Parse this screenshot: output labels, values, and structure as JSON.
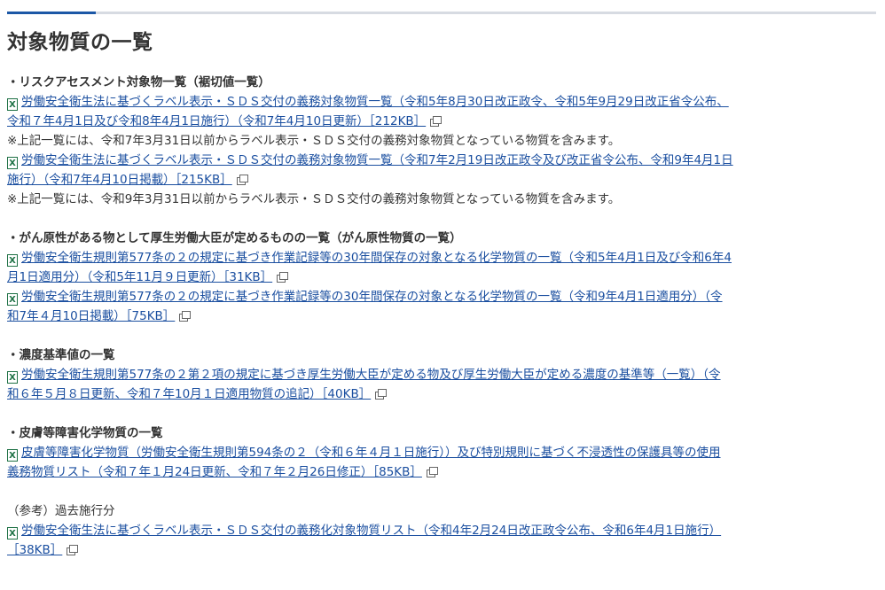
{
  "page_title": "対象物質の一覧",
  "colors": {
    "accent": "#1b57a6",
    "link": "#1b4fa0",
    "excel_icon": "#1e7145"
  },
  "sections": [
    {
      "heading": "・リスクアセスメント対象物一覧（裾切値一覧）",
      "items": [
        {
          "type": "link",
          "icon": "excel-icon",
          "line1": "労働安全衛生法に基づくラベル表示・ＳＤＳ交付の義務対象物質一覧（令和5年8月30日改正政令、令和5年9月29日改正省令公布、",
          "line2": "令和７年4月1日及び令和8年4月1日施行）（令和7年4月10日更新）［212KB］"
        },
        {
          "type": "note",
          "text": "※上記一覧には、令和7年3月31日以前からラベル表示・ＳＤＳ交付の義務対象物質となっている物質を含みます。"
        },
        {
          "type": "link",
          "icon": "excel-icon",
          "line1": "労働安全衛生法に基づくラベル表示・ＳＤＳ交付の義務対象物質一覧（令和7年2月19日改正政令及び改正省令公布、令和9年4月1日",
          "line2": "施行）（令和7年4月10日掲載）［215KB］"
        },
        {
          "type": "note",
          "text": "※上記一覧には、令和9年3月31日以前からラベル表示・ＳＤＳ交付の義務対象物質となっている物質を含みます。"
        }
      ]
    },
    {
      "heading": "・がん原性がある物として厚生労働大臣が定めるものの一覧（がん原性物質の一覧）",
      "items": [
        {
          "type": "link",
          "icon": "excel-icon",
          "line1": "労働安全衛生規則第577条の２の規定に基づき作業記録等の30年間保存の対象となる化学物質の一覧（令和5年4月1日及び令和6年4",
          "line2": "月1日適用分）（令和5年11月９日更新）［31KB］"
        },
        {
          "type": "link",
          "icon": "excel-icon",
          "line1": "労働安全衛生規則第577条の２の規定に基づき作業記録等の30年間保存の対象となる化学物質の一覧（令和9年4月1日適用分）（令",
          "line2": "和7年４月10日掲載）［75KB］"
        }
      ]
    },
    {
      "heading": "・濃度基準値の一覧",
      "items": [
        {
          "type": "link",
          "icon": "excel-icon",
          "line1": "労働安全衛生規則第577条の２第２項の規定に基づき厚生労働大臣が定める物及び厚生労働大臣が定める濃度の基準等（一覧）（令",
          "line2": "和６年５月８日更新、令和７年10月１日適用物質の追記）［40KB］"
        }
      ]
    },
    {
      "heading": "・皮膚等障害化学物質の一覧",
      "items": [
        {
          "type": "link",
          "icon": "excel-icon",
          "line1": "皮膚等障害化学物質（労働安全衛生規則第594条の２（令和６年４月１日施行））及び特別規則に基づく不浸透性の保護具等の使用",
          "line2": "義務物質リスト（令和７年１月24日更新、令和７年２月26日修正）［85KB］"
        }
      ]
    },
    {
      "heading": "（参考）過去施行分",
      "plain": true,
      "items": [
        {
          "type": "link",
          "icon": "excel-icon",
          "line1": "労働安全衛生法に基づくラベル表示・ＳＤＳ交付の義務化対象物質リスト（令和4年2月24日改正政令公布、令和6年4月1日施行）",
          "line2": "［38KB］"
        }
      ]
    }
  ]
}
